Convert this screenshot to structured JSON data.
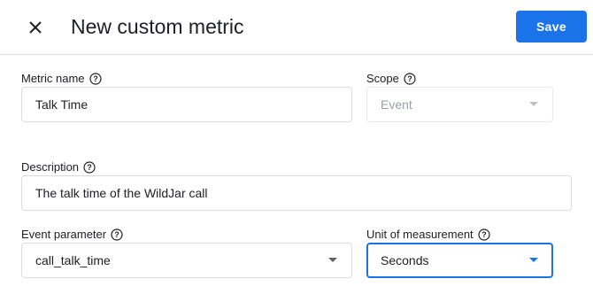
{
  "header": {
    "title": "New custom metric",
    "save_label": "Save"
  },
  "metric_name": {
    "label": "Metric name",
    "value": "Talk Time"
  },
  "scope": {
    "label": "Scope",
    "selected": "Event"
  },
  "description": {
    "label": "Description",
    "value": "The talk time of the WildJar call"
  },
  "event_parameter": {
    "label": "Event parameter",
    "selected": "call_talk_time"
  },
  "unit_of_measurement": {
    "label": "Unit of measurement",
    "selected": "Seconds"
  },
  "colors": {
    "accent": "#1a73e8",
    "text": "#202124",
    "disabled_text": "#9aa0a6",
    "border": "#dadce0"
  },
  "icons": {
    "close": "close-icon",
    "help": "help-circle-icon",
    "dropdown": "chevron-down-icon"
  }
}
